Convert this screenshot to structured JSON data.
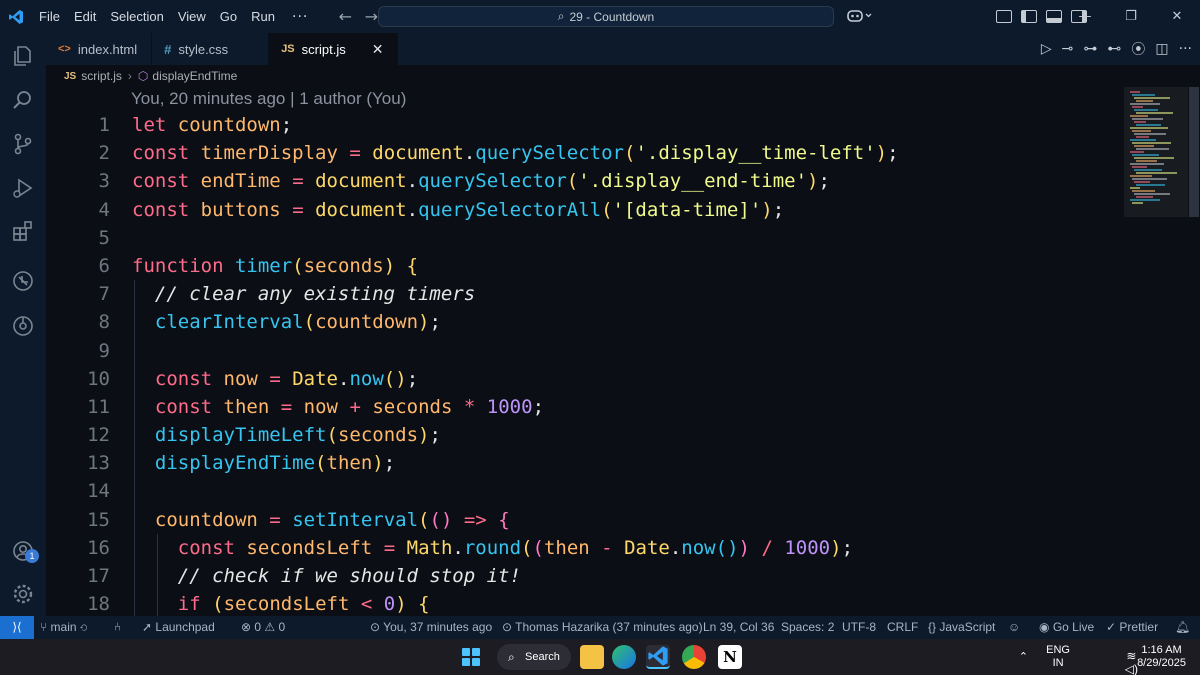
{
  "menu": {
    "items": [
      "File",
      "Edit",
      "Selection",
      "View",
      "Go",
      "Run"
    ],
    "more": "···"
  },
  "command_center": {
    "text": "29 - Countdown"
  },
  "tabs": [
    {
      "label": "index.html",
      "glyph": "<>",
      "glyph_color": "#e37933",
      "active": false
    },
    {
      "label": "style.css",
      "glyph": "#",
      "glyph_color": "#519aba",
      "active": false
    },
    {
      "label": "script.js",
      "glyph": "JS",
      "glyph_color": "#e5c07b",
      "active": true
    }
  ],
  "tab_close": "✕",
  "breadcrumb": {
    "file": "script.js",
    "file_glyph": "JS",
    "symbol": "displayEndTime"
  },
  "blame": "You, 20 minutes ago | 1 author (You)",
  "line_numbers": [
    "1",
    "2",
    "3",
    "4",
    "5",
    "6",
    "7",
    "8",
    "9",
    "10",
    "11",
    "12",
    "13",
    "14",
    "15",
    "16",
    "17",
    "18"
  ],
  "code_lines": [
    "let countdown;",
    "const timerDisplay = document.querySelector('.display__time-left');",
    "const endTime = document.querySelector('.display__end-time');",
    "const buttons = document.querySelectorAll('[data-time]');",
    "",
    "function timer(seconds) {",
    "  // clear any existing timers",
    "  clearInterval(countdown);",
    "",
    "  const now = Date.now();",
    "  const then = now + seconds * 1000;",
    "  displayTimeLeft(seconds);",
    "  displayEndTime(then);",
    "",
    "  countdown = setInterval(() => {",
    "    const secondsLeft = Math.round((then - Date.now()) / 1000);",
    "    // check if we should stop it!",
    "    if (secondsLeft < 0) {"
  ],
  "status": {
    "branch": "main",
    "launchpad": "Launchpad",
    "problems": "⊗ 0 ⚠ 0",
    "blame_current": "You, 37 minutes ago",
    "blame_author": "Thomas Hazarika (37 minutes ago)",
    "cursor": "Ln 39, Col 36",
    "spaces": "Spaces: 2",
    "encoding": "UTF-8",
    "eol": "CRLF",
    "language": "JavaScript",
    "go_live": "Go Live",
    "prettier": "Prettier"
  },
  "account_badge": "1",
  "taskbar": {
    "search": "Search",
    "lang_top": "ENG",
    "lang_bottom": "IN",
    "time": "1:16 AM",
    "date": "8/29/2025"
  },
  "colors": {
    "accent": "#1a6fd1",
    "keyword": "#ff6b8b",
    "variable": "#ffb86c",
    "function": "#36c5f0",
    "string": "#f1fa8c",
    "number": "#bd93f9"
  }
}
